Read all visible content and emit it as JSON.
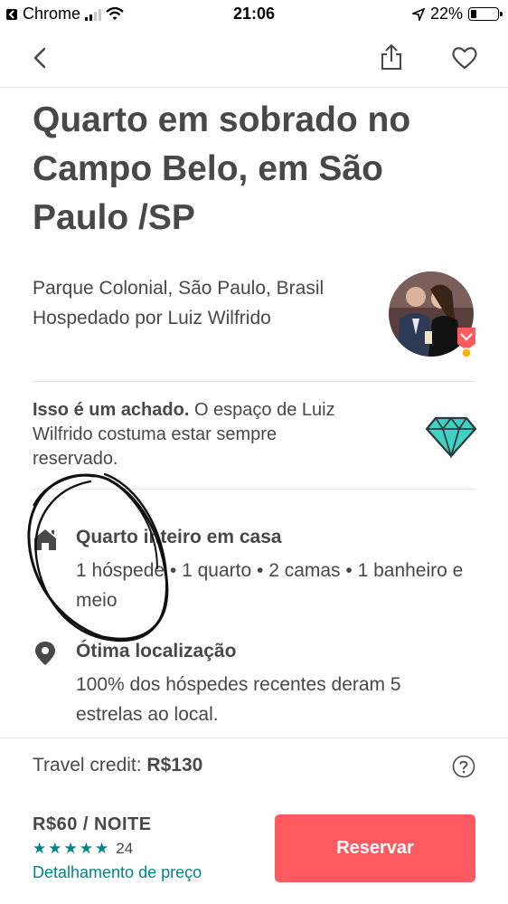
{
  "status_bar": {
    "app_back_label": "Chrome",
    "time": "21:06",
    "battery_text": "22%",
    "battery_level": 0.22
  },
  "nav": {
    "back_icon": "chevron-left-icon",
    "share_icon": "share-icon",
    "favorite_icon": "heart-icon"
  },
  "listing": {
    "title": "Quarto em sobrado no Campo Belo, em São Paulo /SP",
    "location": "Parque Colonial, São Paulo, Brasil",
    "host_line": "Hospedado por Luiz Wilfrido"
  },
  "rare_find": {
    "bold": "Isso é um achado.",
    "text": " O espaço de Luiz Wilfrido costuma estar sempre reservado."
  },
  "features": [
    {
      "icon": "house-icon",
      "heading": "Quarto inteiro em casa",
      "description": "1 hóspede • 1 quarto • 2 camas • 1 banheiro e meio"
    },
    {
      "icon": "location-pin-icon",
      "heading": "Ótima localização",
      "description": "100% dos hóspedes recentes deram 5 estrelas ao local."
    }
  ],
  "credit": {
    "label": "Travel credit: ",
    "amount": "R$130"
  },
  "booking": {
    "price": "R$60 / NOITE",
    "rating": 5,
    "reviews": "24",
    "breakdown_link": "Detalhamento de preço",
    "reserve_button": "Reservar"
  },
  "colors": {
    "accent": "#ff5a5f",
    "teal": "#008489",
    "text": "#484848"
  }
}
